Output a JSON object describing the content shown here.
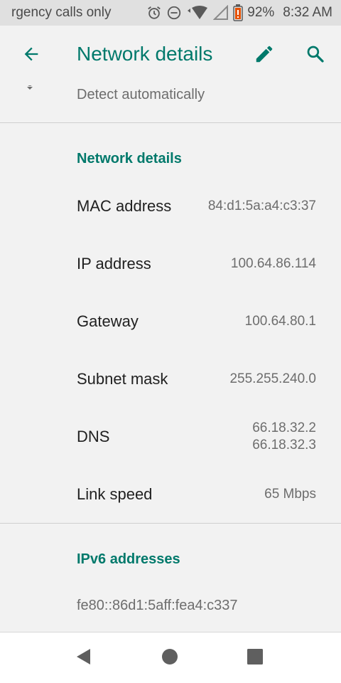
{
  "status_bar": {
    "carrier_text": "rgency calls only",
    "battery_percent": "92%",
    "time": "8:32 AM",
    "icons": [
      "alarm-icon",
      "do-not-disturb-icon",
      "wifi-icon",
      "cell-signal-icon",
      "battery-icon"
    ]
  },
  "app_bar": {
    "title": "Network details",
    "back_icon": "arrow-back-icon",
    "edit_icon": "pencil-icon",
    "search_icon": "search-icon"
  },
  "partial_row": {
    "text": "Detect automatically"
  },
  "network_details": {
    "header": "Network details",
    "rows": [
      {
        "label": "MAC address",
        "value": "84:d1:5a:a4:c3:37"
      },
      {
        "label": "IP address",
        "value": "100.64.86.114"
      },
      {
        "label": "Gateway",
        "value": "100.64.80.1"
      },
      {
        "label": "Subnet mask",
        "value": "255.255.240.0"
      },
      {
        "label": "DNS",
        "value_line1": "66.18.32.2",
        "value_line2": "66.18.32.3"
      },
      {
        "label": "Link speed",
        "value": "65 Mbps"
      }
    ]
  },
  "ipv6": {
    "header": "IPv6 addresses",
    "value": "fe80::86d1:5aff:fea4:c337"
  },
  "nav_bar": {
    "back": "back-triangle-icon",
    "home": "home-circle-icon",
    "recents": "recents-square-icon"
  },
  "colors": {
    "accent": "#00796b",
    "status_bar_bg": "#e0e0e0",
    "page_bg": "#f2f2f2",
    "nav_icon": "#5f5f5f",
    "battery_alert": "#e65100"
  }
}
